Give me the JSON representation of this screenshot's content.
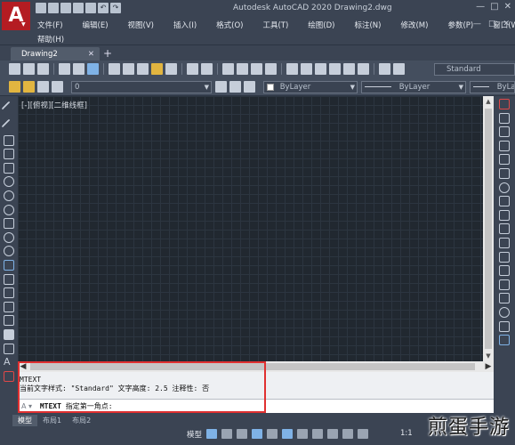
{
  "title": "Autodesk AutoCAD 2020    Drawing2.dwg",
  "window_controls": [
    "—",
    "□",
    "✕"
  ],
  "menu": [
    "文件(F)",
    "编辑(E)",
    "视图(V)",
    "插入(I)",
    "格式(O)",
    "工具(T)",
    "绘图(D)",
    "标注(N)",
    "修改(M)",
    "参数(P)",
    "窗口(W)"
  ],
  "menu_row2": "帮助(H)",
  "tabs": {
    "document": "Drawing2",
    "close": "✕",
    "add": "+"
  },
  "toolbar": {
    "text_style": "Standard",
    "layer_value": "0",
    "color": "ByLayer",
    "linetype": "ByLayer",
    "lineweight": "ByLa"
  },
  "viewport_label": "[-][俯视][二维线框]",
  "command": {
    "history_line1": "MTEXT",
    "history_line2": "当前文字样式: \"Standard\"  文字高度:  2.5  注释性:  否",
    "input_command": "MTEXT",
    "input_prompt": "指定第一角点:"
  },
  "status": {
    "layout_tabs": [
      "模型",
      "布局1",
      "布局2"
    ],
    "model_label": "模型",
    "scale": "1:1"
  },
  "watermark": "煎蛋手游",
  "colors": {
    "accent_red": "#e03030",
    "logo_red": "#b41c22",
    "ui_dark": "#3b4453",
    "canvas": "#212830"
  }
}
